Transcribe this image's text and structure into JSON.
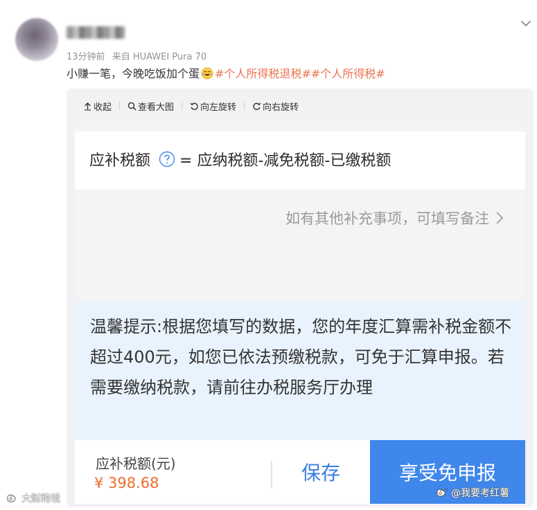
{
  "post": {
    "time": "13分钟前",
    "source": "来自 HUAWEI Pura 70",
    "text": "小赚一笔，今晚吃饭加个蛋",
    "emoji": "laugh-cry-emoji",
    "hashtags": [
      "#个人所得税退税#",
      "#个人所得税#"
    ]
  },
  "toolbar": {
    "collapse": "收起",
    "view_large": "查看大图",
    "rotate_left": "向左旋转",
    "rotate_right": "向右旋转"
  },
  "screenshot": {
    "formula": {
      "label": "应补税额",
      "expression": "= 应纳税额-减免税额-已缴税额"
    },
    "remark": "如有其他补充事项，可填写备注",
    "tip": "温馨提示:根据您填写的数据，您的年度汇算需补税金额不超过400元，如您已依法预缴税款，可免于汇算申报。若需要缴纳税款，请前往办税服务厅办理",
    "due_label": "应补税额(元)",
    "due_amount": "¥ 398.68",
    "save_button": "保存",
    "exempt_button": "享受免申报"
  },
  "watermarks": {
    "left": "大财跨境",
    "right": "@我要考红薯"
  },
  "colors": {
    "hashtag": "#eb7350",
    "amount": "#ee6b2b",
    "primary_button": "#3f87eb",
    "save_text": "#3a7ee0",
    "tip_background": "#e9f3fd"
  }
}
